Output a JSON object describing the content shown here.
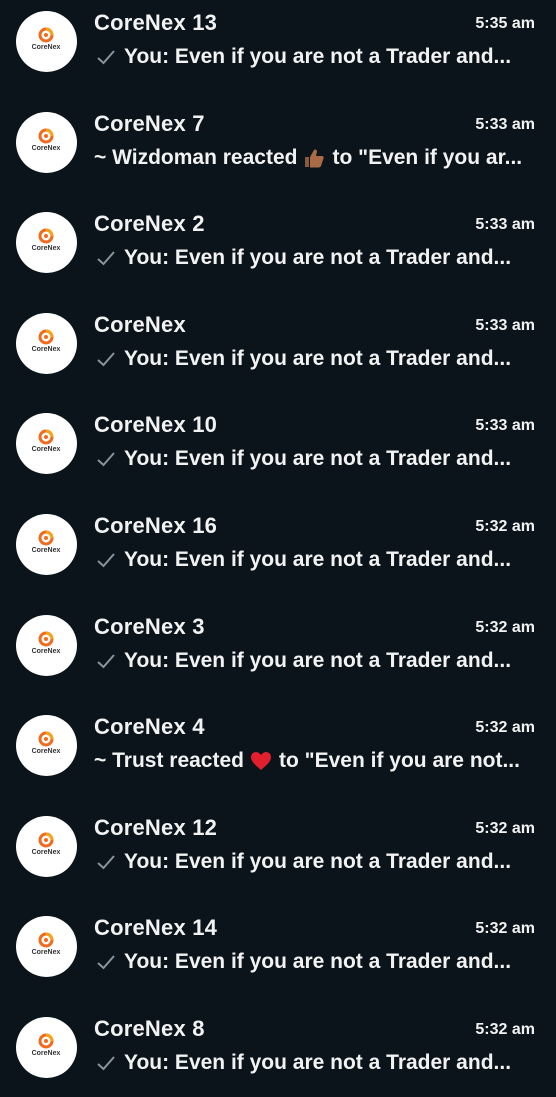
{
  "colors": {
    "background": "#0b141a",
    "text": "#f2f2f2",
    "tick": "#8a9499",
    "logo_orange": "#f26b1d",
    "avatar_bg": "#ffffff"
  },
  "avatar": {
    "logo_text": "CoreNex"
  },
  "chats": [
    {
      "name": "CoreNex 13",
      "time": "5:35 am",
      "preview": "You: Even if you are not a Trader and...",
      "status_icon": "check-icon"
    },
    {
      "name": "CoreNex 7",
      "time": "5:33 am",
      "preview_before": "~ Wizdoman reacted",
      "reaction_icon": "thumbs-up-icon",
      "preview_after": "to \"Even if you ar..."
    },
    {
      "name": "CoreNex 2",
      "time": "5:33 am",
      "preview": "You: Even if you are not a Trader and...",
      "status_icon": "check-icon"
    },
    {
      "name": "CoreNex",
      "time": "5:33 am",
      "preview": "You: Even if you are not a Trader and...",
      "status_icon": "check-icon"
    },
    {
      "name": "CoreNex 10",
      "time": "5:33 am",
      "preview": "You: Even if you are not a Trader and...",
      "status_icon": "check-icon"
    },
    {
      "name": "CoreNex 16",
      "time": "5:32 am",
      "preview": "You: Even if you are not a Trader and...",
      "status_icon": "check-icon"
    },
    {
      "name": "CoreNex 3",
      "time": "5:32 am",
      "preview": "You: Even if you are not a Trader and...",
      "status_icon": "check-icon"
    },
    {
      "name": "CoreNex 4",
      "time": "5:32 am",
      "preview_before": "~ Trust reacted",
      "reaction_icon": "heart-icon",
      "preview_after": "to \"Even if you are not..."
    },
    {
      "name": "CoreNex 12",
      "time": "5:32 am",
      "preview": "You: Even if you are not a Trader and...",
      "status_icon": "check-icon"
    },
    {
      "name": "CoreNex 14",
      "time": "5:32 am",
      "preview": "You: Even if you are not a Trader and...",
      "status_icon": "check-icon"
    },
    {
      "name": "CoreNex 8",
      "time": "5:32 am",
      "preview": "You: Even if you are not a Trader and...",
      "status_icon": "check-icon"
    }
  ]
}
